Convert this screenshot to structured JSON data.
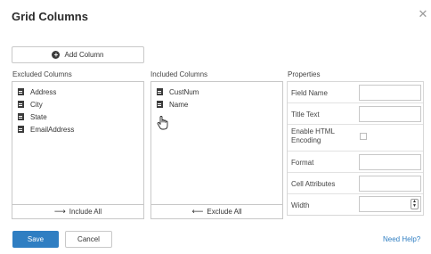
{
  "dialog": {
    "title": "Grid Columns",
    "close_icon": "close-icon"
  },
  "toolbar": {
    "add_column_label": "Add Column",
    "add_icon": "plus-circle-icon"
  },
  "excluded": {
    "label": "Excluded Columns",
    "items": [
      "Address",
      "City",
      "State",
      "EmailAddress"
    ],
    "footer_label": "Include All",
    "footer_icon": "arrow-right-icon"
  },
  "included": {
    "label": "Included Columns",
    "items": [
      "CustNum",
      "Name"
    ],
    "footer_label": "Exclude All",
    "footer_icon": "arrow-left-icon"
  },
  "properties": {
    "label": "Properties",
    "field_name": "Field Name",
    "title_text": "Title Text",
    "enable_html": "Enable HTML Encoding",
    "format": "Format",
    "cell_attributes": "Cell Attributes",
    "width": "Width"
  },
  "footer": {
    "save_label": "Save",
    "cancel_label": "Cancel",
    "help_label": "Need Help?"
  },
  "colors": {
    "primary": "#2f7ec2",
    "link": "#2f7ec2"
  }
}
